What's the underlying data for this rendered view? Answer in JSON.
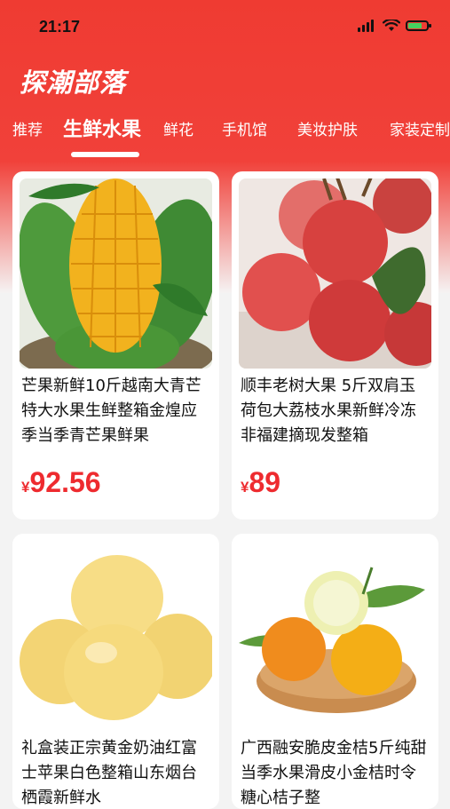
{
  "status": {
    "time": "21:17"
  },
  "app": {
    "title": "探潮部落"
  },
  "tabs": [
    {
      "label": "推荐"
    },
    {
      "label": "生鲜水果"
    },
    {
      "label": "鲜花"
    },
    {
      "label": "手机馆"
    },
    {
      "label": "美妆护肤"
    },
    {
      "label": "家装定制"
    }
  ],
  "active_tab_index": 1,
  "products": [
    {
      "title": "芒果新鲜10斤越南大青芒特大水果生鲜整箱金煌应季当季青芒果鲜果",
      "currency": "¥",
      "price": "92.56",
      "image": "mango-image"
    },
    {
      "title": "顺丰老树大果 5斤双肩玉荷包大荔枝水果新鲜冷冻非福建摘现发整箱",
      "currency": "¥",
      "price": "89",
      "image": "lychee-image"
    },
    {
      "title": "礼盒装正宗黄金奶油红富士苹果白色整箱山东烟台栖霞新鲜水",
      "currency": "",
      "price": "",
      "image": "golden-apple-image"
    },
    {
      "title": "广西融安脆皮金桔5斤纯甜当季水果滑皮小金桔时令糖心桔子整",
      "currency": "",
      "price": "",
      "image": "kumquat-image"
    }
  ],
  "colors": {
    "brand": "#ee3a31",
    "price": "#ee2b2f"
  }
}
